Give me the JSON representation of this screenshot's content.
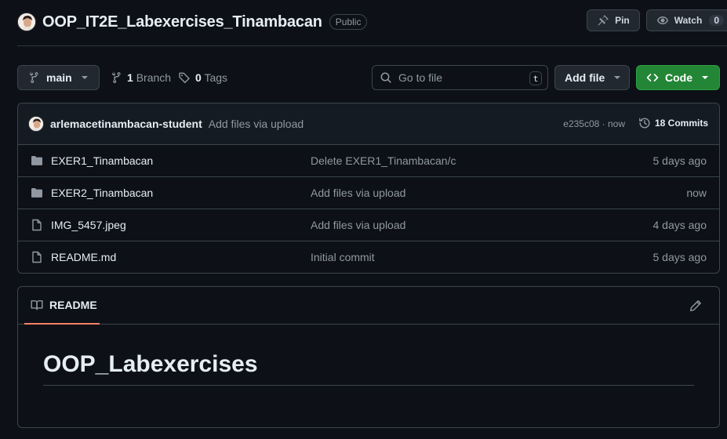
{
  "repo": {
    "name": "OOP_IT2E_Labexercises_Tinambacan",
    "visibility": "Public"
  },
  "header_actions": {
    "pin_label": "Pin",
    "watch_label": "Watch",
    "watch_count": "0"
  },
  "toolbar": {
    "branch": "main",
    "branch_count": "1",
    "branch_label": "Branch",
    "tag_count": "0",
    "tag_label": "Tags",
    "search_placeholder": "Go to file",
    "search_shortcut": "t",
    "add_file_label": "Add file",
    "code_label": "Code"
  },
  "latest_commit": {
    "author": "arlemacetinambacan-student",
    "message": "Add files via upload",
    "meta": "e235c08 · now",
    "commits_label": "18 Commits"
  },
  "files": [
    {
      "type": "folder",
      "name": "EXER1_Tinambacan",
      "commit": "Delete EXER1_Tinambacan/c",
      "date": "5 days ago"
    },
    {
      "type": "folder",
      "name": "EXER2_Tinambacan",
      "commit": "Add files via upload",
      "date": "now"
    },
    {
      "type": "file",
      "name": "IMG_5457.jpeg",
      "commit": "Add files via upload",
      "date": "4 days ago"
    },
    {
      "type": "file",
      "name": "README.md",
      "commit": "Initial commit",
      "date": "5 days ago"
    }
  ],
  "readme": {
    "tab_label": "README",
    "title": "OOP_Labexercises"
  },
  "colors": {
    "background": "#0d1117",
    "border": "#3d444d",
    "code_button": "#238636",
    "tab_underline": "#f78166",
    "muted_text": "#9198a1"
  }
}
